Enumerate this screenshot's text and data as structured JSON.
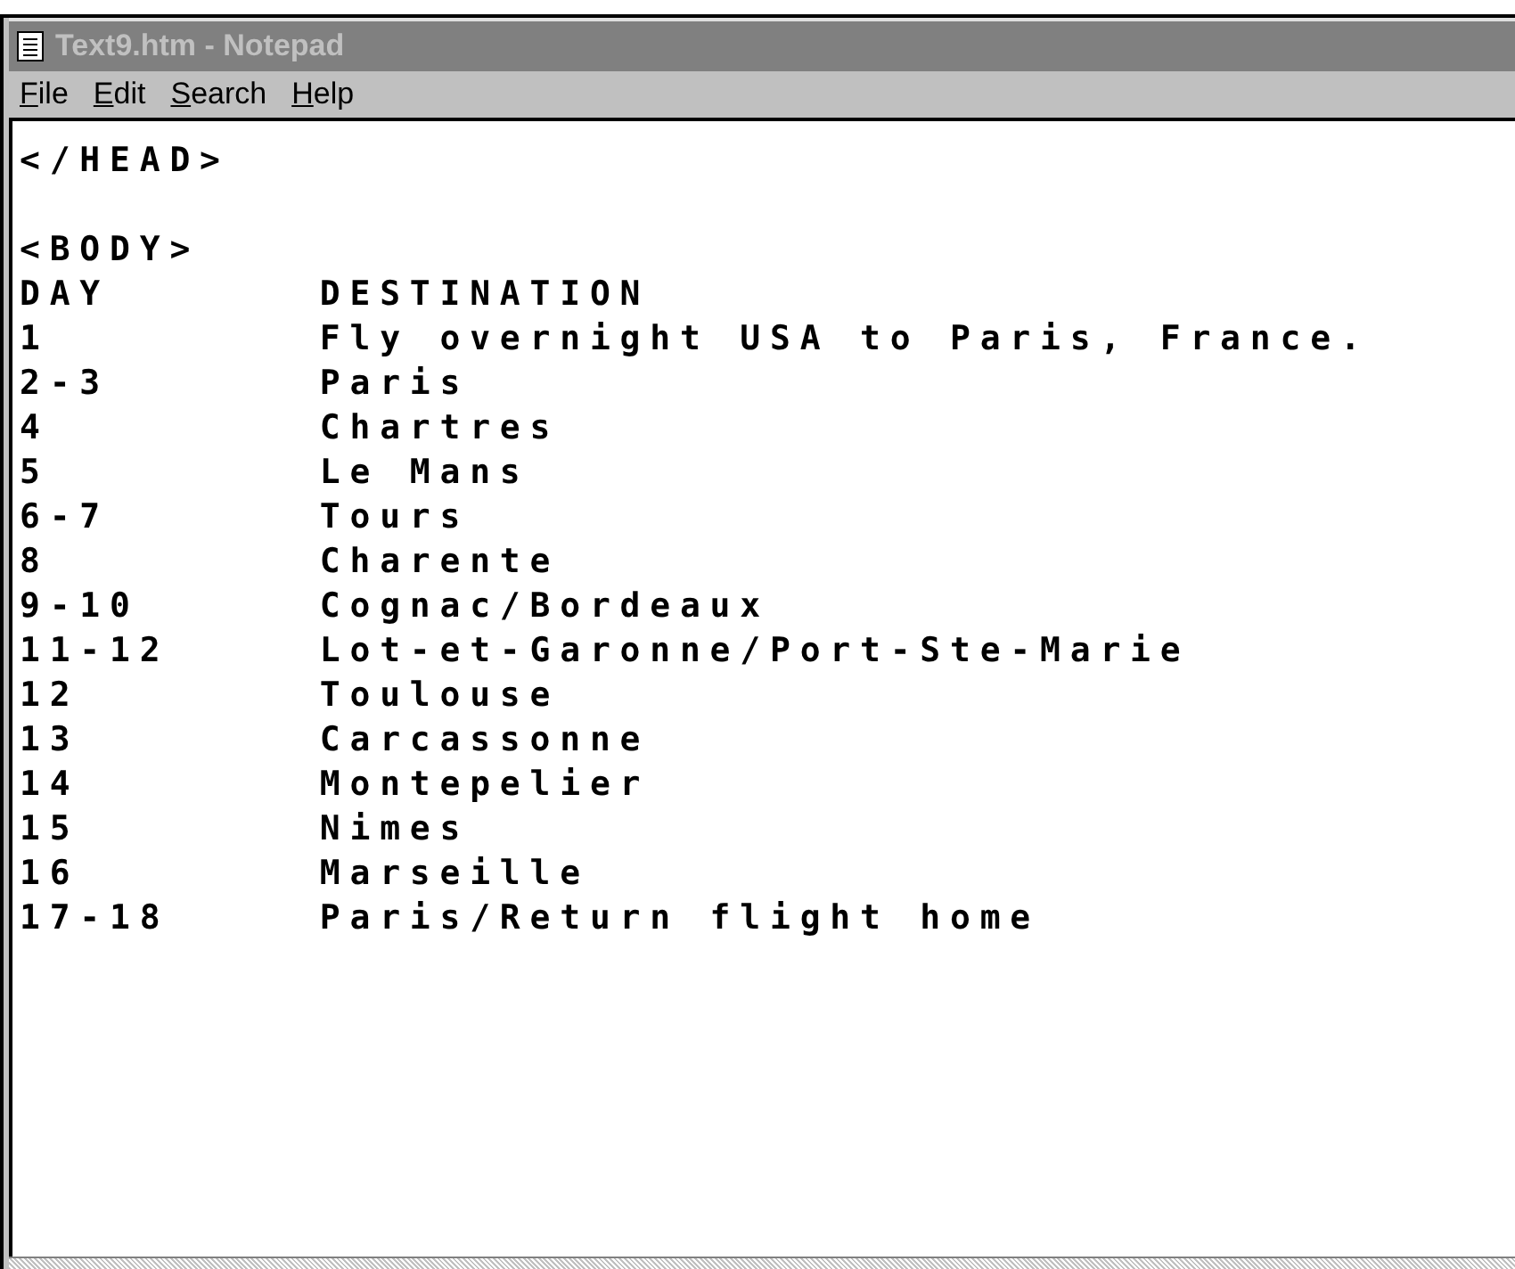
{
  "window": {
    "title": "Text9.htm - Notepad"
  },
  "menu": [
    {
      "label": "File"
    },
    {
      "label": "Edit"
    },
    {
      "label": "Search"
    },
    {
      "label": "Help"
    }
  ],
  "editor": {
    "head_lines": [
      "</HEAD>"
    ],
    "body_lines": [
      "<BODY>",
      "DAY\tDESTINATION",
      "1\tFly overnight USA to Paris, France.",
      "2-3\tParis",
      "4\tChartres",
      "5\tLe Mans",
      "6-7\tTours",
      "8\tCharente",
      "9-10\tCognac/Bordeaux",
      "11-12\tLot-et-Garonne/Port-Ste-Marie",
      "12\tToulouse",
      "13\tCarcassonne",
      "14\tMontepelier",
      "15\tNimes",
      "16\tMarseille",
      "17-18\tParis/Return flight home"
    ]
  }
}
